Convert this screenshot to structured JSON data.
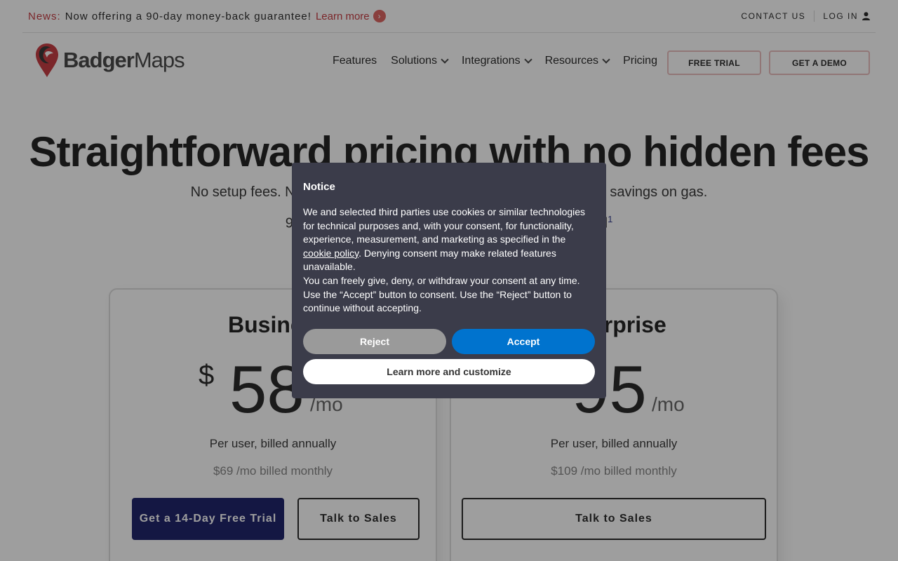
{
  "news": {
    "tag": "News:",
    "text": "Now offering a 90-day money-back guarantee!",
    "link": "Learn more"
  },
  "util": {
    "contact": "CONTACT US",
    "login": "LOG IN"
  },
  "logo": {
    "bold": "Badger",
    "light": "Maps"
  },
  "nav": {
    "features": "Features",
    "solutions": "Solutions",
    "integrations": "Integrations",
    "resources": "Resources",
    "pricing": "Pricing",
    "free_trial": "FREE TRIAL",
    "demo": "GET A DEMO"
  },
  "hero": {
    "title": "Straightforward pricing with no hidden fees",
    "sub_left": "No setup fees. No in",
    "sub_right": "t the savings on gas.",
    "sub2_left": "90",
    "sub2_right": "d",
    "footnote": "1"
  },
  "plans": [
    {
      "name_visible": "Busine",
      "currency": "$",
      "price_visible": "58",
      "per": "/mo",
      "billed": "Per user, billed annually",
      "monthly": "$69 /mo billed monthly",
      "primary_btn": "Get a 14-Day Free Trial",
      "secondary_btn": "Talk to Sales"
    },
    {
      "name_visible": "erprise",
      "price_visible": "95",
      "per": "/mo",
      "billed": "Per user, billed annually",
      "monthly": "$109 /mo billed monthly",
      "secondary_btn": "Talk to Sales"
    }
  ],
  "notice": {
    "title": "Notice",
    "body_1": "We and selected third parties use cookies or similar technologies for technical purposes and, with your consent, for functionality, experience, measurement, and marketing as specified in the ",
    "policy_link": "cookie policy",
    "body_2": ". Denying consent may make related features unavailable.",
    "body_3": "You can freely give, deny, or withdraw your consent at any time. Use the “Accept” button to consent. Use the “Reject” button to continue without accepting.",
    "reject": "Reject",
    "accept": "Accept",
    "learn": "Learn more and customize"
  },
  "colors": {
    "brand_red": "#c0262c",
    "navy": "#050a5a",
    "accept_blue": "#0073ce",
    "modal_bg": "#3b3c4a"
  }
}
